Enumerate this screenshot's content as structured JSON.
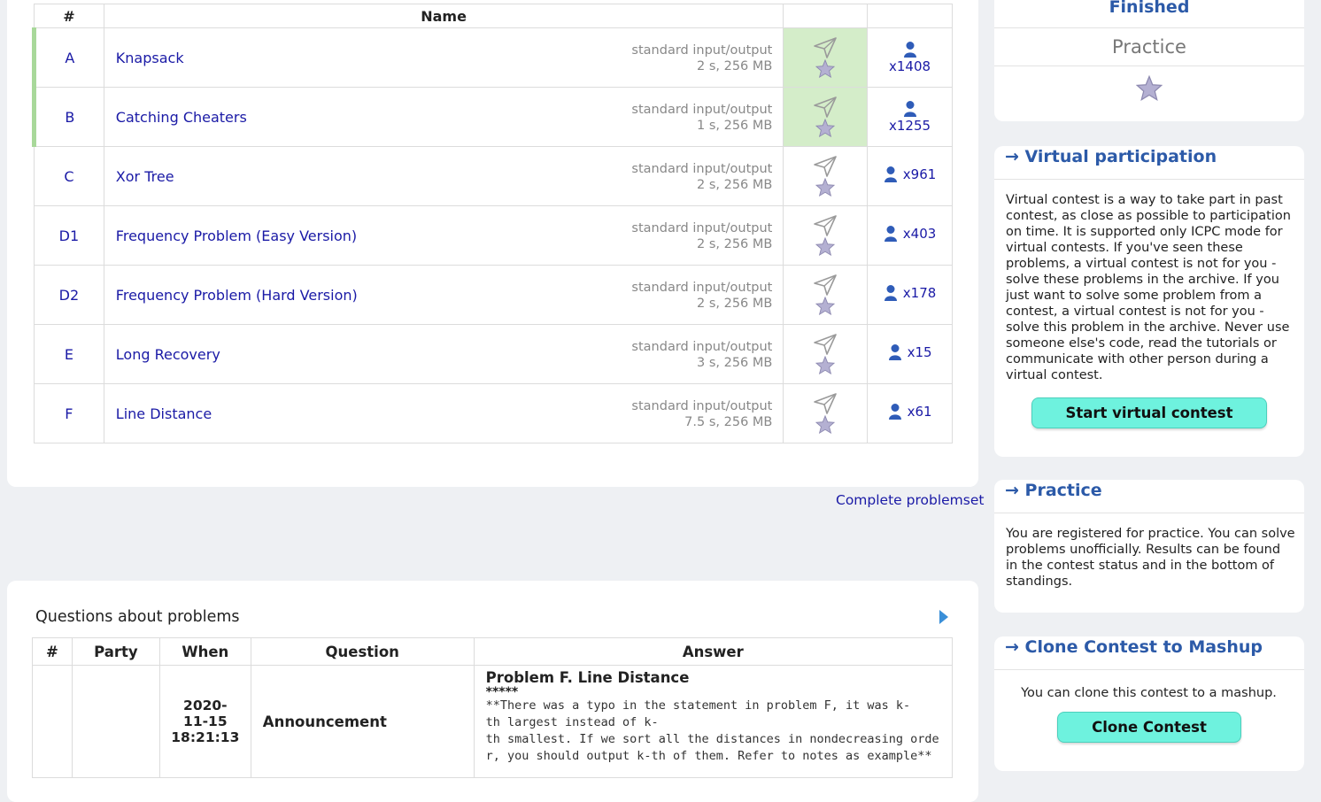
{
  "problems_table": {
    "headers": {
      "num": "#",
      "name": "Name"
    },
    "rows": [
      {
        "id": "A",
        "name": "Knapsack",
        "io": "standard input/output",
        "limits": "2 s, 256 MB",
        "solvers": "x1408",
        "solved": true
      },
      {
        "id": "B",
        "name": "Catching Cheaters",
        "io": "standard input/output",
        "limits": "1 s, 256 MB",
        "solvers": "x1255",
        "solved": true
      },
      {
        "id": "C",
        "name": "Xor Tree",
        "io": "standard input/output",
        "limits": "2 s, 256 MB",
        "solvers": "x961",
        "solved": false
      },
      {
        "id": "D1",
        "name": "Frequency Problem (Easy Version)",
        "io": "standard input/output",
        "limits": "2 s, 256 MB",
        "solvers": "x403",
        "solved": false
      },
      {
        "id": "D2",
        "name": "Frequency Problem (Hard Version)",
        "io": "standard input/output",
        "limits": "2 s, 256 MB",
        "solvers": "x178",
        "solved": false
      },
      {
        "id": "E",
        "name": "Long Recovery",
        "io": "standard input/output",
        "limits": "3 s, 256 MB",
        "solvers": "x15",
        "solved": false
      },
      {
        "id": "F",
        "name": "Line Distance",
        "io": "standard input/output",
        "limits": "7.5 s, 256 MB",
        "solvers": "x61",
        "solved": false
      }
    ]
  },
  "complete_problemset_link": "Complete problemset",
  "questions": {
    "title": "Questions about problems",
    "headers": {
      "num": "#",
      "party": "Party",
      "when": "When",
      "question": "Question",
      "answer": "Answer"
    },
    "row": {
      "when_line1": "2020-",
      "when_line2": "11-15",
      "when_line3": "18:21:13",
      "question": "Announcement",
      "answer_title": "Problem F. Line Distance",
      "answer_stars": "*****",
      "answer_line1": "**There was a typo in the statement in problem F, it was k-",
      "answer_line2": "th largest instead of k-",
      "answer_line3": "th smallest. If we sort all the distances in nondecreasing orde",
      "answer_line4": "r, you should output k-th of them. Refer to notes as example**"
    }
  },
  "sidebar": {
    "status": {
      "finished": "Finished",
      "practice": "Practice"
    },
    "virtual": {
      "title": "→ Virtual participation",
      "text": "Virtual contest is a way to take part in past contest, as close as possible to participation on time. It is supported only ICPC mode for virtual contests. If you've seen these problems, a virtual contest is not for you - solve these problems in the archive. If you just want to solve some problem from a contest, a virtual contest is not for you - solve this problem in the archive. Never use someone else's code, read the tutorials or communicate with other person during a virtual contest.",
      "button": "Start virtual contest"
    },
    "practice": {
      "title": "→ Practice",
      "text": "You are registered for practice. You can solve problems unofficially. Results can be found in the contest status and in the bottom of standings."
    },
    "clone": {
      "title": "→ Clone Contest to Mashup",
      "text": "You can clone this contest to a mashup.",
      "button": "Clone Contest"
    }
  },
  "colors": {
    "link": "#1a1aa6",
    "solved_bg": "#d4edc9",
    "button_bg": "#6ef2de",
    "sidebar_title": "#2c5aa8"
  },
  "icons": {
    "submit": "paper-plane-icon",
    "favourite": "star-icon",
    "solvers": "user-icon",
    "next": "triangle-right-icon"
  }
}
